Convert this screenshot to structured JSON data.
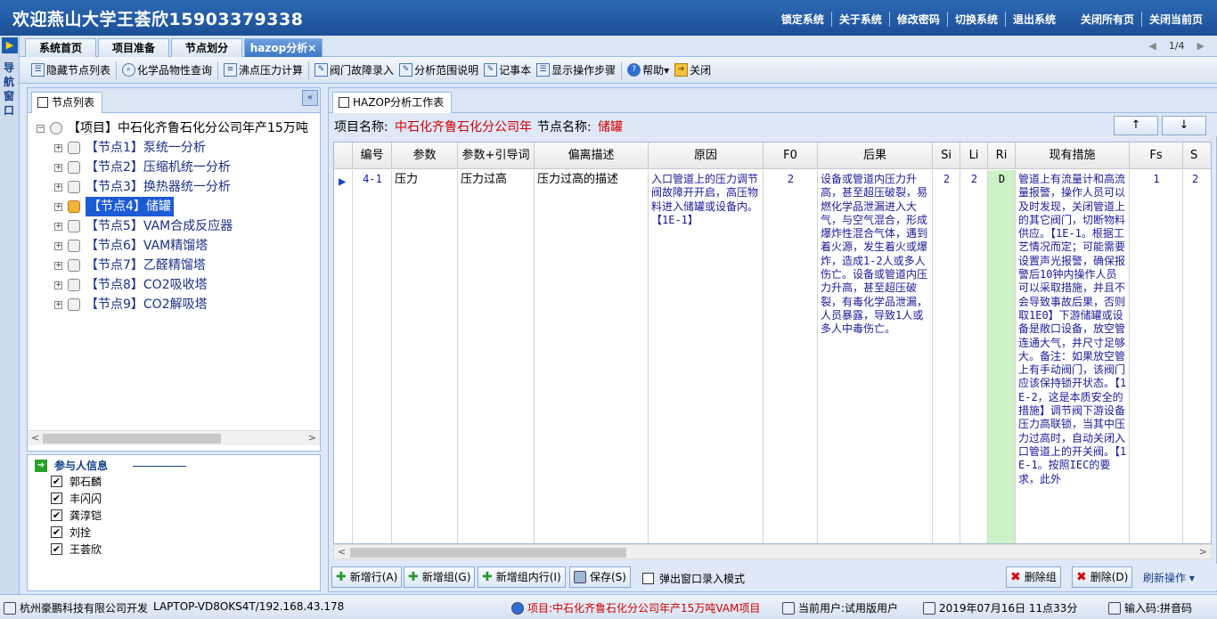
{
  "header": {
    "title": "欢迎燕山大学王荟欣15903379338",
    "links": [
      "锁定系统",
      "关于系统",
      "修改密码",
      "切换系统",
      "退出系统"
    ],
    "right_links": [
      "关闭所有页",
      "关闭当前页"
    ]
  },
  "nav_strip": {
    "label": "导航窗口"
  },
  "tabs": [
    {
      "label": "系统首页"
    },
    {
      "label": "项目准备"
    },
    {
      "label": "节点划分"
    },
    {
      "label": "hazop分析"
    }
  ],
  "tab_close": "×",
  "pager": {
    "prev": "◀",
    "text": "1/4",
    "next": "▶"
  },
  "toolbar": [
    {
      "label": "隐藏节点列表",
      "icon": "list-icon"
    },
    {
      "label": "化学品物性查询",
      "icon": "search-icon"
    },
    {
      "label": "沸点压力计算",
      "icon": "document-icon"
    },
    {
      "label": "阀门故障录入",
      "icon": "edit-icon"
    },
    {
      "label": "分析范围说明",
      "icon": "edit-icon"
    },
    {
      "label": "记事本",
      "icon": "notepad-icon"
    },
    {
      "label": "显示操作步骤",
      "icon": "steps-icon"
    },
    {
      "label": "帮助▾",
      "icon": "help-icon"
    },
    {
      "label": "关闭",
      "icon": "close-icon"
    }
  ],
  "node_panel": {
    "tab": "节点列表",
    "collapse": "«",
    "root": "【项目】中石化齐鲁石化分公司年产15万吨",
    "expand": "⊟",
    "nodes": [
      {
        "label": "【节点1】泵统一分析"
      },
      {
        "label": "【节点2】压缩机统一分析"
      },
      {
        "label": "【节点3】换热器统一分析"
      },
      {
        "label": "【节点4】储罐",
        "selected": true
      },
      {
        "label": "【节点5】VAM合成反应器"
      },
      {
        "label": "【节点6】VAM精馏塔"
      },
      {
        "label": "【节点7】乙醛精馏塔"
      },
      {
        "label": "【节点8】CO2吸收塔"
      },
      {
        "label": "【节点9】CO2解吸塔"
      }
    ],
    "node_expand": "⊞",
    "scroll_left": "<",
    "scroll_right": ">"
  },
  "participants": {
    "title": "参与人信息",
    "people": [
      "郭石麟",
      "丰闪闪",
      "龚淳铠",
      "刘拴",
      "王荟欣"
    ],
    "check": "✔"
  },
  "worksheet": {
    "tab": "HAZOP分析工作表",
    "project_label": "项目名称:",
    "project_value": "中石化齐鲁石化分公司年",
    "node_label": "节点名称:",
    "node_value": "储罐",
    "up": "↑",
    "down": "↓",
    "columns": [
      "",
      "编号",
      "参数",
      "参数+引导词",
      "偏离描述",
      "原因",
      "F0",
      "后果",
      "Si",
      "Li",
      "Ri",
      "现有措施",
      "Fs",
      "S"
    ],
    "row": {
      "marker": "▶",
      "id": "4-1",
      "param": "压力",
      "param_guide": "压力过高",
      "deviation": "压力过高的描述",
      "cause": "入口管道上的压力调节阀故障开开启，高压物料进入储罐或设备内。【1E-1】",
      "f0": "2",
      "consequence": "设备或管道内压力升高，甚至超压破裂，易燃化学品泄漏进入大气，与空气混合，形成爆炸性混合气体，遇到着火源，发生着火或爆炸，造成1-2人或多人伤亡。设备或管道内压力升高，甚至超压破裂，有毒化学品泄漏，人员暴露，导致1人或多人中毒伤亡。",
      "si": "2",
      "li": "2",
      "ri": "D",
      "measures": "管道上有流量计和高流量报警，操作人员可以及时发现，关闭管道上的其它阀门，切断物料供应。【1E-1。根据工艺情况而定；可能需要设置声光报警，确保报警后10钟内操作人员可以采取措施，并且不会导致事故后果，否则取1E0】下游储罐或设备是敞口设备，放空管连通大气，并尺寸足够大。备注：如果放空管上有手动阀门，该阀门应该保持锁开状态。【1E-2，这是本质安全的措施】调节阀下游设备压力高联锁，当其中压力过高时，自动关闭入口管道上的开关阀。【1E-1。按照IEC的要求，此外",
      "fs": "1",
      "s": "2"
    },
    "buttons": {
      "add_row": "新增行(A)",
      "add_group": "新增组(G)",
      "add_in_group": "新增组内行(I)",
      "save": "保存(S)",
      "popup_mode": "弹出窗口录入模式",
      "delete_group": "删除组",
      "delete": "删除(D)",
      "refresh": "刷新操作 ▾"
    },
    "colors": {
      "ri_bg": "#cdf2c7",
      "red": "#d00000"
    }
  },
  "statusbar": {
    "company": "杭州豪鹏科技有限公司开发",
    "host": "LAPTOP-VD8OKS4T/192.168.43.178",
    "project": "项目:中石化齐鲁石化分公司年产15万吨VAM项目",
    "user": "当前用户:试用版用户",
    "datetime": "2019年07月16日 11点33分",
    "input": "输入码:拼音码"
  }
}
